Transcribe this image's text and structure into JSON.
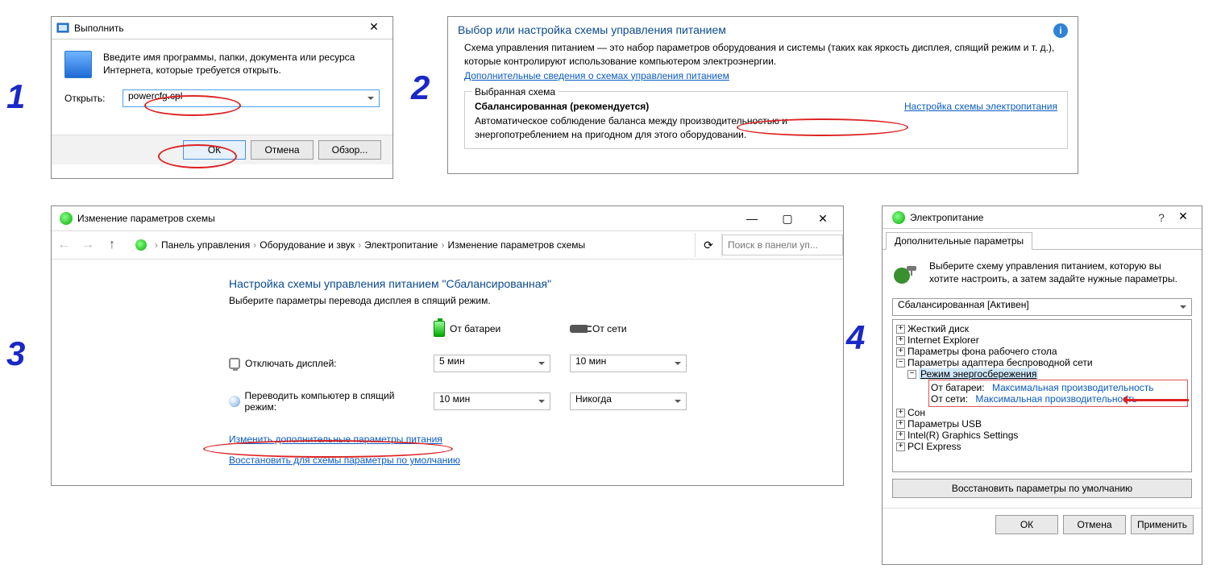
{
  "steps": {
    "one": "1",
    "two": "2",
    "three": "3",
    "four": "4"
  },
  "run": {
    "title": "Выполнить",
    "hint": "Введите имя программы, папки, документа или ресурса Интернета, которые требуется открыть.",
    "open_label": "Открыть:",
    "input_value": "powercfg.cpl",
    "ok": "ОК",
    "cancel": "Отмена",
    "browse": "Обзор..."
  },
  "power": {
    "heading": "Выбор или настройка схемы управления питанием",
    "desc1": "Схема управления питанием — это набор параметров оборудования и системы (таких как яркость дисплея, спящий режим и т. д.), которые контролируют использование компьютером электроэнергии.",
    "more_link": "Дополнительные сведения о схемах управления питанием",
    "fieldset_label": "Выбранная схема",
    "plan_name": "Сбалансированная (рекомендуется)",
    "plan_desc": "Автоматическое соблюдение баланса между производительностью и энергопотреблением на пригодном для этого оборудовании.",
    "config_link": "Настройка схемы электропитания"
  },
  "plan": {
    "window_title": "Изменение параметров схемы",
    "breadcrumb": [
      "Панель управления",
      "Оборудование и звук",
      "Электропитание",
      "Изменение параметров схемы"
    ],
    "search_placeholder": "Поиск в панели уп...",
    "page_title": "Настройка схемы управления питанием \"Сбалансированная\"",
    "subtitle": "Выберите параметры перевода дисплея в спящий режим.",
    "col_battery": "От батареи",
    "col_ac": "От сети",
    "row_display": "Отключать дисплей:",
    "row_sleep": "Переводить компьютер в спящий режим:",
    "disp_battery": "5 мин",
    "disp_ac": "10 мин",
    "sleep_battery": "10 мин",
    "sleep_ac": "Никогда",
    "adv_link": "Изменить дополнительные параметры питания",
    "restore_link": "Восстановить для схемы параметры по умолчанию"
  },
  "adv": {
    "window_title": "Электропитание",
    "tab": "Дополнительные параметры",
    "intro": "Выберите схему управления питанием, которую вы хотите настроить, а затем задайте нужные параметры.",
    "plan_selected": "Сбалансированная [Активен]",
    "tree": {
      "hdd": "Жесткий диск",
      "ie": "Internet Explorer",
      "wallpaper": "Параметры фона рабочего стола",
      "wifi": "Параметры адаптера беспроводной сети",
      "powersave": "Режим энергосбережения",
      "batt_label": "От батареи:",
      "batt_val": "Максимальная производительность",
      "ac_label": "От сети:",
      "ac_val": "Максимальная производительность",
      "sleep": "Сон",
      "usb": "Параметры USB",
      "gfx": "Intel(R) Graphics Settings",
      "pci": "PCI Express"
    },
    "restore": "Восстановить параметры по умолчанию",
    "ok": "ОК",
    "cancel": "Отмена",
    "apply": "Применить"
  }
}
